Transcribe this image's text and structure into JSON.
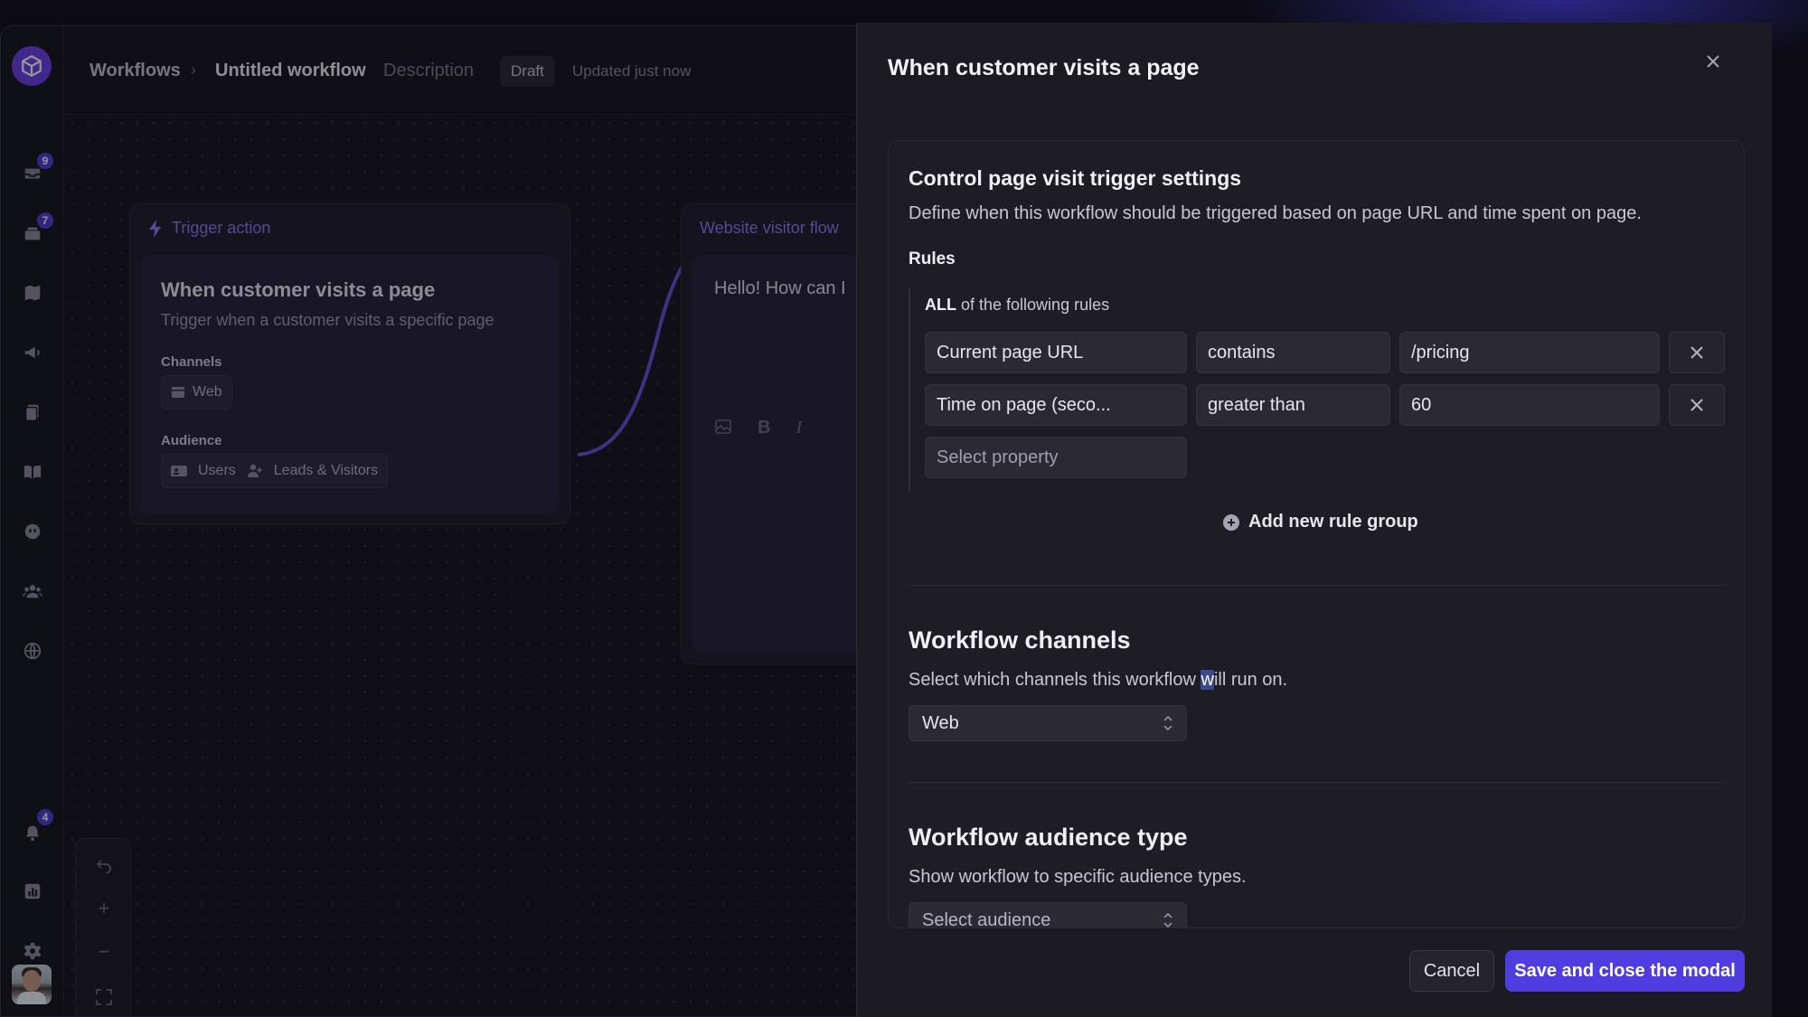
{
  "header": {
    "breadcrumb_root": "Workflows",
    "workflow_name": "Untitled workflow",
    "description_link": "Description",
    "status_badge": "Draft",
    "updated_text": "Updated just now"
  },
  "sidebar": {
    "badges": {
      "inbox": "9",
      "conversations": "7",
      "notifications": "4"
    },
    "items": [
      {
        "icon": "inbox-icon"
      },
      {
        "icon": "stack-icon"
      },
      {
        "icon": "map-icon"
      },
      {
        "icon": "megaphone-icon"
      },
      {
        "icon": "documents-icon"
      },
      {
        "icon": "book-icon"
      },
      {
        "icon": "bot-icon"
      },
      {
        "icon": "users-icon"
      },
      {
        "icon": "globe-icon"
      },
      {
        "icon": "bell-icon"
      },
      {
        "icon": "chart-icon"
      },
      {
        "icon": "gear-icon"
      }
    ]
  },
  "canvas": {
    "trigger_node": {
      "title": "Trigger action",
      "card_title": "When customer visits a page",
      "card_subtitle": "Trigger when a customer visits a specific page",
      "channels_label": "Channels",
      "channel": "Web",
      "audience_label": "Audience",
      "audience_users": "Users",
      "audience_leads": "Leads & Visitors"
    },
    "message_node": {
      "title": "Website visitor flow",
      "message_preview": "Hello! How can I"
    }
  },
  "modal": {
    "title": "When customer visits a page",
    "trigger_settings": {
      "heading": "Control page visit trigger settings",
      "description": "Define when this workflow should be triggered based on page URL and time spent on page.",
      "rules_label": "Rules",
      "match_mode": "ALL",
      "match_suffix": " of the following rules",
      "rules": [
        {
          "property": "Current page URL",
          "operator": "contains",
          "value": "/pricing"
        },
        {
          "property": "Time on page (seco...",
          "operator": "greater than",
          "value": "60"
        }
      ],
      "new_property_placeholder": "Select property",
      "add_group_label": "Add new rule group"
    },
    "channels": {
      "heading": "Workflow channels",
      "description_before": "Select which channels this workflow ",
      "description_highlight": "w",
      "description_after": "ill run on.",
      "selected": "Web"
    },
    "audience": {
      "heading": "Workflow audience type",
      "description": "Show workflow to specific audience types.",
      "placeholder": "Select audience"
    },
    "cancel_label": "Cancel",
    "save_label": "Save and close the modal"
  },
  "colors": {
    "accent": "#4f3de0",
    "node_title": "#8b7cf6",
    "background": "#17161f"
  }
}
